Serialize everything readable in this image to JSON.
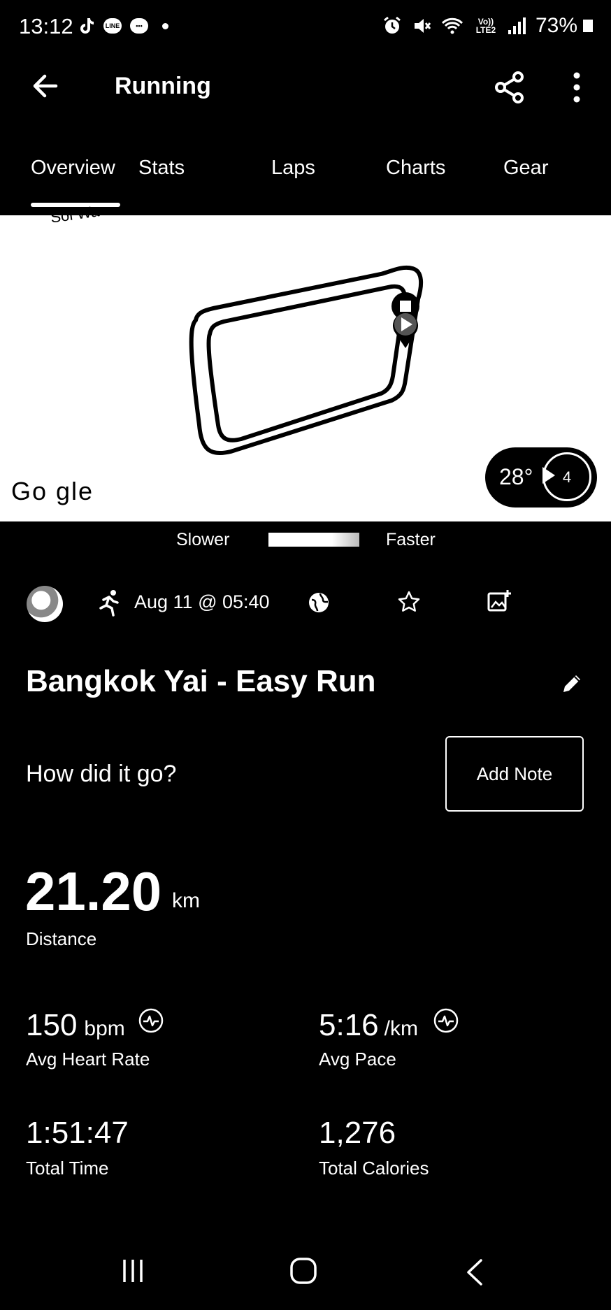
{
  "status_bar": {
    "time": "13:12",
    "left_icons": [
      "tiktok-icon",
      "line-icon",
      "message-icon",
      "dot-icon"
    ],
    "right_icons": [
      "alarm-icon",
      "mute-icon",
      "wifi-icon",
      "lte-icon",
      "signal-icon"
    ],
    "lte_label": "Vo)) LTE2",
    "battery": "73%"
  },
  "header": {
    "title": "Running",
    "back_icon": "arrow-left-icon",
    "share_icon": "share-icon",
    "more_icon": "more-vertical-icon"
  },
  "tabs": [
    {
      "label": "Overview",
      "active": true
    },
    {
      "label": "Stats",
      "active": false
    },
    {
      "label": "Laps",
      "active": false
    },
    {
      "label": "Charts",
      "active": false
    },
    {
      "label": "Gear",
      "active": false
    }
  ],
  "map": {
    "street_label": "Soi Wa",
    "attribution": "Go  gle",
    "weather": {
      "temp": "28°",
      "wind": "4"
    }
  },
  "pace_legend": {
    "slower": "Slower",
    "faster": "Faster"
  },
  "meta": {
    "date": "Aug 11 @ 05:40",
    "icons": [
      "avatar",
      "running-icon",
      "globe-icon",
      "star-icon",
      "add-photo-icon"
    ]
  },
  "activity": {
    "name": "Bangkok Yai - Easy Run"
  },
  "note": {
    "prompt": "How did it go?",
    "button": "Add Note"
  },
  "stats": {
    "distance": {
      "value": "21.20",
      "unit": "km",
      "label": "Distance"
    },
    "avg_hr": {
      "value": "150",
      "unit": "bpm",
      "label": "Avg Heart Rate"
    },
    "avg_pace": {
      "value": "5:16",
      "unit": "/km",
      "label": "Avg Pace"
    },
    "total_time": {
      "value": "1:51:47",
      "label": "Total Time"
    },
    "calories": {
      "value": "1,276",
      "label": "Total Calories"
    }
  },
  "nav_bar": {
    "icons": [
      "recent-apps-icon",
      "home-icon",
      "back-icon"
    ]
  }
}
